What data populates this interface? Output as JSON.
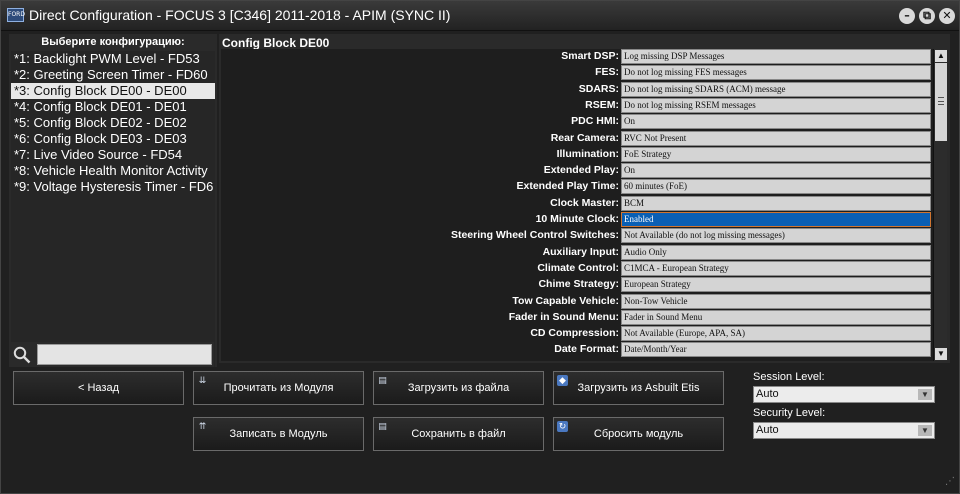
{
  "window": {
    "title": "Direct Configuration - FOCUS 3 [C346] 2011-2018 - APIM (SYNC II)",
    "logo_text": "FORD",
    "minimize_glyph": "–",
    "restore_glyph": "⧉",
    "close_glyph": "✕"
  },
  "sidebar": {
    "header": "Выберите конфигурацию:",
    "items": [
      {
        "label": "*1: Backlight PWM Level - FD53"
      },
      {
        "label": "*2: Greeting Screen Timer - FD60"
      },
      {
        "label": "*3: Config Block DE00 - DE00"
      },
      {
        "label": "*4: Config Block DE01 - DE01"
      },
      {
        "label": "*5: Config Block DE02 - DE02"
      },
      {
        "label": "*6: Config Block DE03 - DE03"
      },
      {
        "label": "*7: Live Video Source - FD54"
      },
      {
        "label": "*8: Vehicle Health Monitor Activity"
      },
      {
        "label": "*9: Voltage Hysteresis Timer - FD6"
      }
    ],
    "selected_index": 2,
    "search_value": ""
  },
  "main": {
    "block_title": "Config Block DE00",
    "params": [
      {
        "label": "Smart DSP:",
        "value": "Log missing DSP Messages"
      },
      {
        "label": "FES:",
        "value": "Do not log missing FES messages"
      },
      {
        "label": "SDARS:",
        "value": "Do not log missing SDARS (ACM) message"
      },
      {
        "label": "RSEM:",
        "value": "Do not log missing RSEM messages"
      },
      {
        "label": "PDC HMI:",
        "value": "On"
      },
      {
        "label": "Rear Camera:",
        "value": "RVC Not Present"
      },
      {
        "label": "Illumination:",
        "value": "FoE Strategy"
      },
      {
        "label": "Extended Play:",
        "value": "On"
      },
      {
        "label": "Extended Play Time:",
        "value": "60 minutes (FoE)"
      },
      {
        "label": "Clock Master:",
        "value": "BCM"
      },
      {
        "label": "10 Minute Clock:",
        "value": "Enabled"
      },
      {
        "label": "Steering Wheel Control Switches:",
        "value": "Not Available (do not log missing messages)"
      },
      {
        "label": "Auxiliary Input:",
        "value": "Audio Only"
      },
      {
        "label": "Climate Control:",
        "value": "C1MCA - European Strategy"
      },
      {
        "label": "Chime Strategy:",
        "value": "European Strategy"
      },
      {
        "label": "Tow Capable Vehicle:",
        "value": "Non-Tow Vehicle"
      },
      {
        "label": "Fader in Sound Menu:",
        "value": "Fader in Sound Menu"
      },
      {
        "label": "CD Compression:",
        "value": "Not Available (Europe, APA, SA)"
      },
      {
        "label": "Date Format:",
        "value": "Date/Month/Year"
      }
    ],
    "active_index": 10
  },
  "buttons": {
    "back": "< Назад",
    "read_module": "Прочитать из Модуля",
    "load_file": "Загрузить из файла",
    "load_asbuilt": "Загрузить из Asbuilt Etis",
    "write_module": "Записать в Модуль",
    "save_file": "Сохранить в файл",
    "reset_module": "Сбросить модуль"
  },
  "session": {
    "label": "Session Level:",
    "value": "Auto"
  },
  "security": {
    "label": "Security Level:",
    "value": "Auto"
  },
  "colors": {
    "selection_blue": "#0a5fb4",
    "selection_border": "#d07530",
    "list_selected_bg": "#e8e8e8"
  },
  "icons": [
    "app-logo-icon",
    "minimize-icon",
    "restore-icon",
    "close-icon",
    "search-icon",
    "scroll-up-icon",
    "scroll-down-icon",
    "dropdown-arrow-icon",
    "resize-grip-icon"
  ]
}
